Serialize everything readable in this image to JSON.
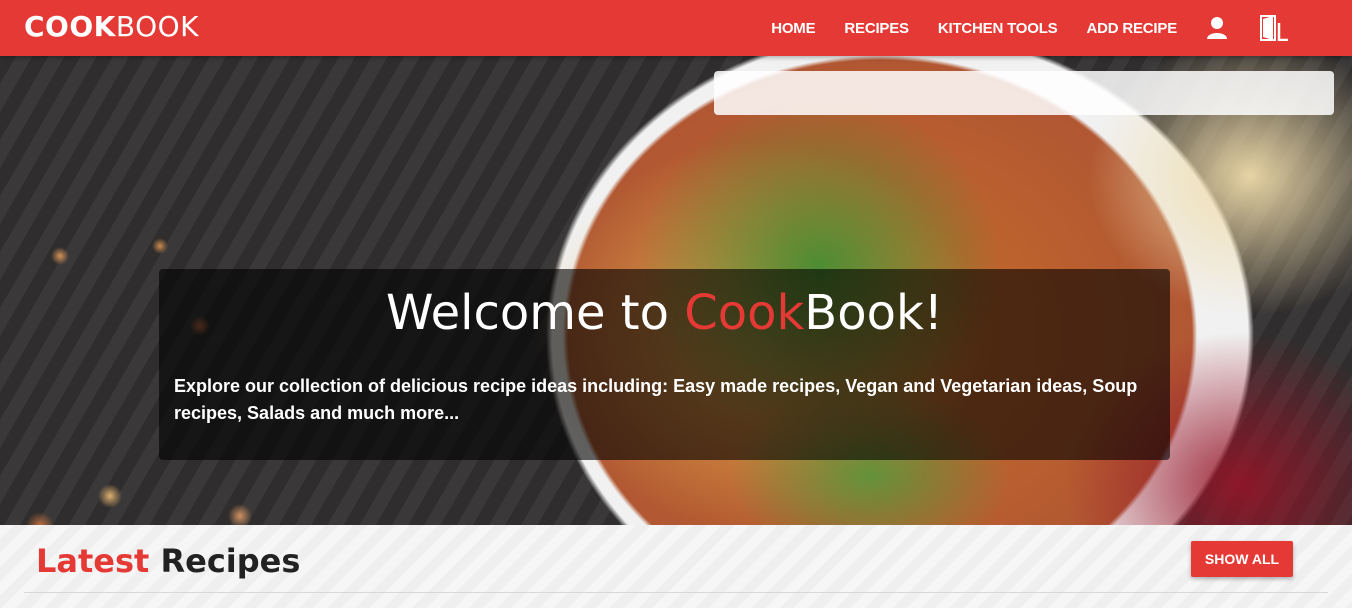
{
  "brand": {
    "part1": "COOK",
    "part2": "BOOK"
  },
  "nav": {
    "items": [
      {
        "label": "HOME"
      },
      {
        "label": "RECIPES"
      },
      {
        "label": "KITCHEN TOOLS"
      },
      {
        "label": "ADD RECIPE"
      }
    ],
    "icons": [
      "user-icon",
      "logout-door-icon"
    ]
  },
  "hero": {
    "search_placeholder": "",
    "welcome": {
      "prefix": "Welcome to ",
      "accent": "Cook",
      "suffix": "Book!"
    },
    "description": "Explore our collection of delicious recipe ideas including: Easy made recipes, Vegan and Vegetarian ideas, Soup recipes, Salads and much more..."
  },
  "latest": {
    "title_accent": "Latest",
    "title_rest": " Recipes",
    "show_all_label": "SHOW ALL"
  },
  "colors": {
    "accent": "#e53935",
    "overlay": "rgba(0,0,0,0.6)"
  }
}
